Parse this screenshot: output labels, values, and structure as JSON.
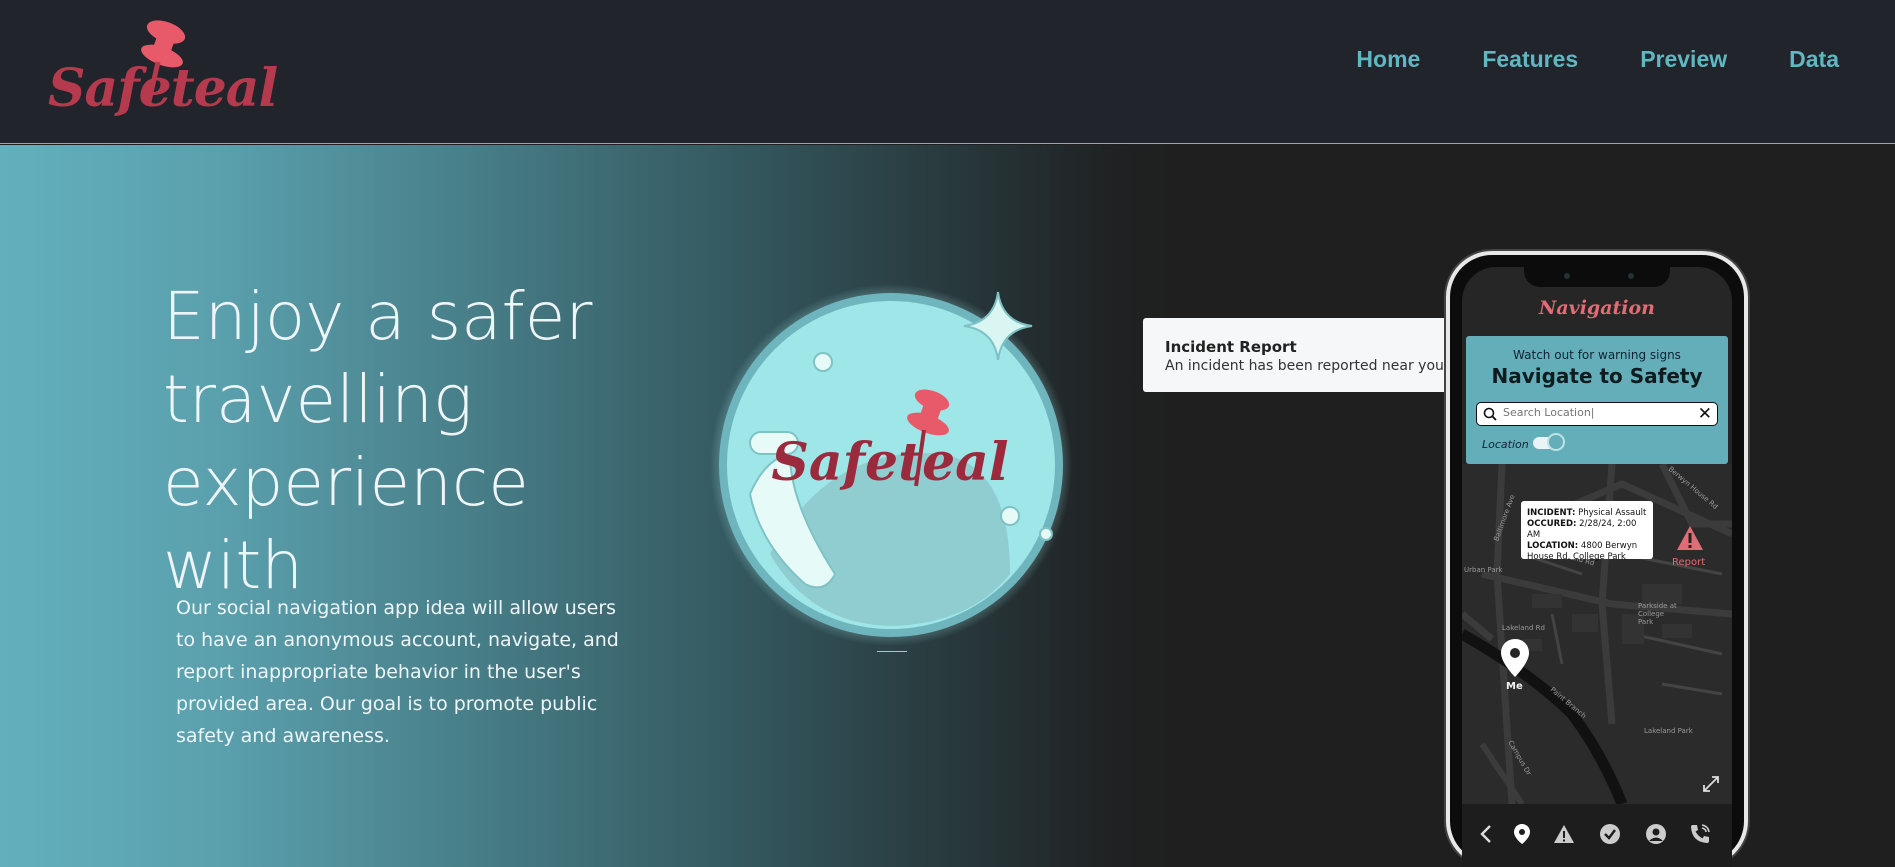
{
  "brand": {
    "name": "Safeteal"
  },
  "nav": {
    "items": [
      {
        "label": "Home"
      },
      {
        "label": "Features"
      },
      {
        "label": "Preview"
      },
      {
        "label": "Data"
      }
    ]
  },
  "hero": {
    "headline": [
      "Enjoy a safer",
      "travelling",
      "experience with"
    ],
    "description": "Our social navigation app idea will allow users to have an anonymous account, navigate, and report inappropriate behavior in the user's provided area. Our goal is to promote public safety and awareness."
  },
  "notification": {
    "title": "Incident Report",
    "body": "An incident has been reported near you."
  },
  "phone": {
    "screen_title": "Navigation",
    "warning": "Watch out for warning signs",
    "heading": "Navigate to Safety",
    "search": {
      "placeholder": "Search Location|"
    },
    "location_label": "Location",
    "incident": {
      "incident_label": "INCIDENT:",
      "incident_value": "Physical Assault",
      "occured_label": "OCCURED:",
      "occured_value": "2/28/24, 2:00 AM",
      "location_label": "LOCATION:",
      "location_value": "4800 Berwyn House Rd, College Park"
    },
    "report_label": "Report",
    "me_label": "Me",
    "map_labels": [
      "Urban Park",
      "Lakeland Rd",
      "Parkside at College Park",
      "Lakeland Park",
      "Berwyn House Rd",
      "Lakeland Rd",
      "Paint Branch",
      "Campus Dr",
      "Baltimore Ave"
    ]
  },
  "colors": {
    "accent": "#5fb7c2",
    "brand": "#b63a4d",
    "alert": "#e06c75"
  }
}
